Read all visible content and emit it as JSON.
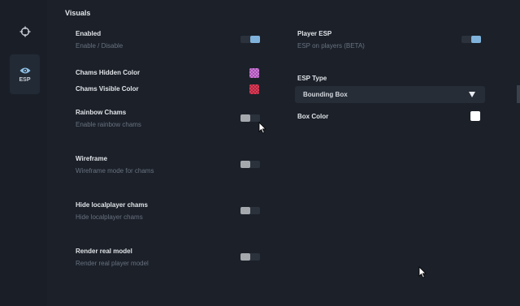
{
  "sidebar": {
    "items": [
      {
        "icon": "crosshair-icon"
      },
      {
        "icon": "eye-icon",
        "label": "ESP"
      }
    ]
  },
  "section": {
    "title": "Visuals"
  },
  "left": {
    "enabled": {
      "label": "Enabled",
      "desc": "Enable / Disable",
      "on": true
    },
    "chams_hidden": {
      "label": "Chams Hidden Color",
      "color": "#c87ad2"
    },
    "chams_visible": {
      "label": "Chams Visible Color",
      "color": "#d83e58"
    },
    "rainbow": {
      "label": "Rainbow Chams",
      "desc": "Enable rainbow chams",
      "on": false
    },
    "wireframe": {
      "label": "Wireframe",
      "desc": "Wireframe mode for chams",
      "on": false
    },
    "hide_local": {
      "label": "Hide localplayer chams",
      "desc": "Hide localplayer chams",
      "on": false
    },
    "render_real": {
      "label": "Render real model",
      "desc": "Render real player model",
      "on": false
    }
  },
  "right": {
    "player_esp": {
      "label": "Player ESP",
      "desc": "ESP on players (BETA)",
      "on": true
    },
    "esp_type": {
      "label": "ESP Type",
      "value": "Bounding Box"
    },
    "box_color": {
      "label": "Box Color",
      "color": "#ffffff"
    }
  },
  "colors": {
    "accent": "#80b3dc",
    "background": "#1b2029",
    "sidebar": "#1a1f27"
  }
}
